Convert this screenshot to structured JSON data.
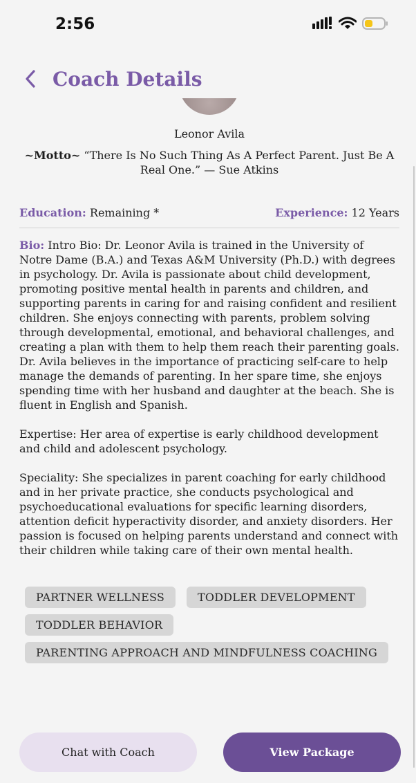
{
  "status_bar": {
    "time": "2:56",
    "icons": [
      "signal-icon",
      "wifi-icon",
      "battery-icon"
    ],
    "battery_color": "#f5c518"
  },
  "header": {
    "title": "Coach Details",
    "back_icon": "chevron-left-icon",
    "accent_color": "#7a5ba7"
  },
  "coach": {
    "name": "Leonor Avila",
    "motto_label": "~Motto~",
    "motto_text": " “There Is No Such Thing As A Perfect Parent. Just Be A Real One.” — Sue Atkins",
    "education_label": "Education:",
    "education_value": " Remaining *",
    "experience_label": "Experience:",
    "experience_value": " 12 Years",
    "bio_label": "Bio:",
    "bio_text": " Intro Bio: Dr. Leonor Avila is trained in the University of Notre Dame (B.A.) and Texas A&M University (Ph.D.) with degrees in psychology. Dr. Avila is passionate about child development, promoting positive mental health in parents and children, and supporting parents in caring for and raising confident and resilient children. She enjoys connecting with parents, problem solving through developmental, emotional, and behavioral challenges, and creating a plan with them to help them reach their parenting goals. Dr. Avila believes in the importance of practicing self-care to help manage the demands of parenting. In her spare time, she enjoys spending time with her husband and daughter at the beach. She is fluent in English and Spanish.",
    "expertise_text": "Expertise: Her area of expertise is early childhood development and child and adolescent psychology.",
    "speciality_text": "Speciality: She specializes in parent coaching for early childhood and in her private practice, she conducts psychological and psychoeducational evaluations for specific learning disorders, attention deficit hyperactivity disorder, and anxiety disorders. Her passion is focused on helping parents understand and connect with their children while taking care of their own mental health."
  },
  "tags": [
    "PARTNER WELLNESS",
    "TODDLER DEVELOPMENT",
    "TODDLER BEHAVIOR",
    "PARENTING APPROACH AND MINDFULNESS COACHING"
  ],
  "actions": {
    "chat_label": "Chat with Coach",
    "package_label": "View Package",
    "primary_color": "#6b4f96",
    "secondary_color": "#e8e0ef"
  }
}
